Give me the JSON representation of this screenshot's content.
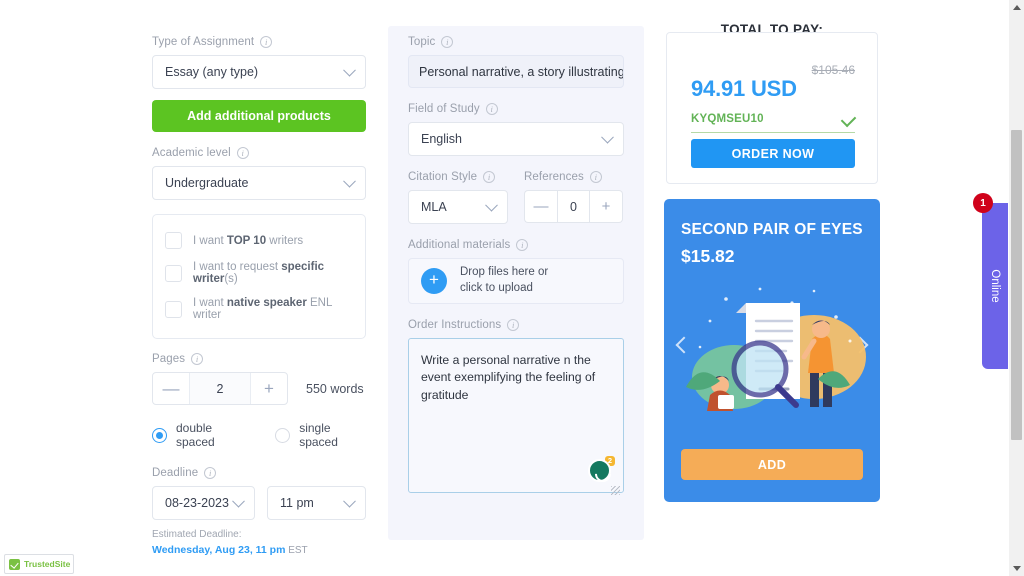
{
  "left": {
    "assignment": {
      "label": "Type of Assignment",
      "value": "Essay (any type)"
    },
    "add_products_label": "Add additional products",
    "academic": {
      "label": "Academic level",
      "value": "Undergraduate"
    },
    "options": [
      {
        "pre": "I want ",
        "strong": "TOP 10",
        "post": " writers"
      },
      {
        "pre": "I want to request ",
        "strong": "specific writer",
        "post": "(s)"
      },
      {
        "pre": "I want ",
        "strong": "native speaker",
        "post": " ENL writer"
      }
    ],
    "pages": {
      "label": "Pages",
      "value": "2",
      "minus": "—",
      "plus": "+",
      "words": "550 words"
    },
    "spacing": [
      {
        "label": "double spaced",
        "selected": true
      },
      {
        "label": "single spaced",
        "selected": false
      }
    ],
    "deadline": {
      "label": "Deadline",
      "date": "08-23-2023",
      "time": "11 pm",
      "estimated_label": "Estimated Deadline:",
      "estimated_value": "Wednesday, Aug 23, 11 pm",
      "estimated_tz": "EST"
    }
  },
  "middle": {
    "topic": {
      "label": "Topic",
      "value": "Personal narrative, a story illustrating a"
    },
    "field_of_study": {
      "label": "Field of Study",
      "value": "English"
    },
    "citation": {
      "label": "Citation Style",
      "value": "MLA"
    },
    "references": {
      "label": "References",
      "value": "0",
      "minus": "—",
      "plus": "+"
    },
    "additional_materials": {
      "label": "Additional materials",
      "plus": "+",
      "line1": "Drop files here or",
      "line2": "click to upload"
    },
    "instructions": {
      "label": "Order Instructions",
      "value": "Write a personal narrative n the event exemplifying the feeling of gratitude",
      "grammarly_badge": "2"
    }
  },
  "right": {
    "total_title": "TOTAL TO PAY:",
    "old_price": "$105.46",
    "new_price": "94.91 USD",
    "promo_code": "KYQMSEU10",
    "order_button": "ORDER NOW",
    "offer": {
      "title": "SECOND PAIR OF EYES",
      "price": "$15.82",
      "add_button": "ADD"
    }
  },
  "chat": {
    "label": "Online",
    "badge": "1"
  },
  "trusted": {
    "part1": "Trusted",
    "part2": "Site",
    "mark": "®"
  },
  "colors": {
    "green": "#5cc422",
    "blue": "#2f9cf4",
    "promo_blue": "#3b8ce8",
    "orange": "#f5ac57",
    "chat_purple": "#6c63e8",
    "badge_red": "#d0021b"
  }
}
